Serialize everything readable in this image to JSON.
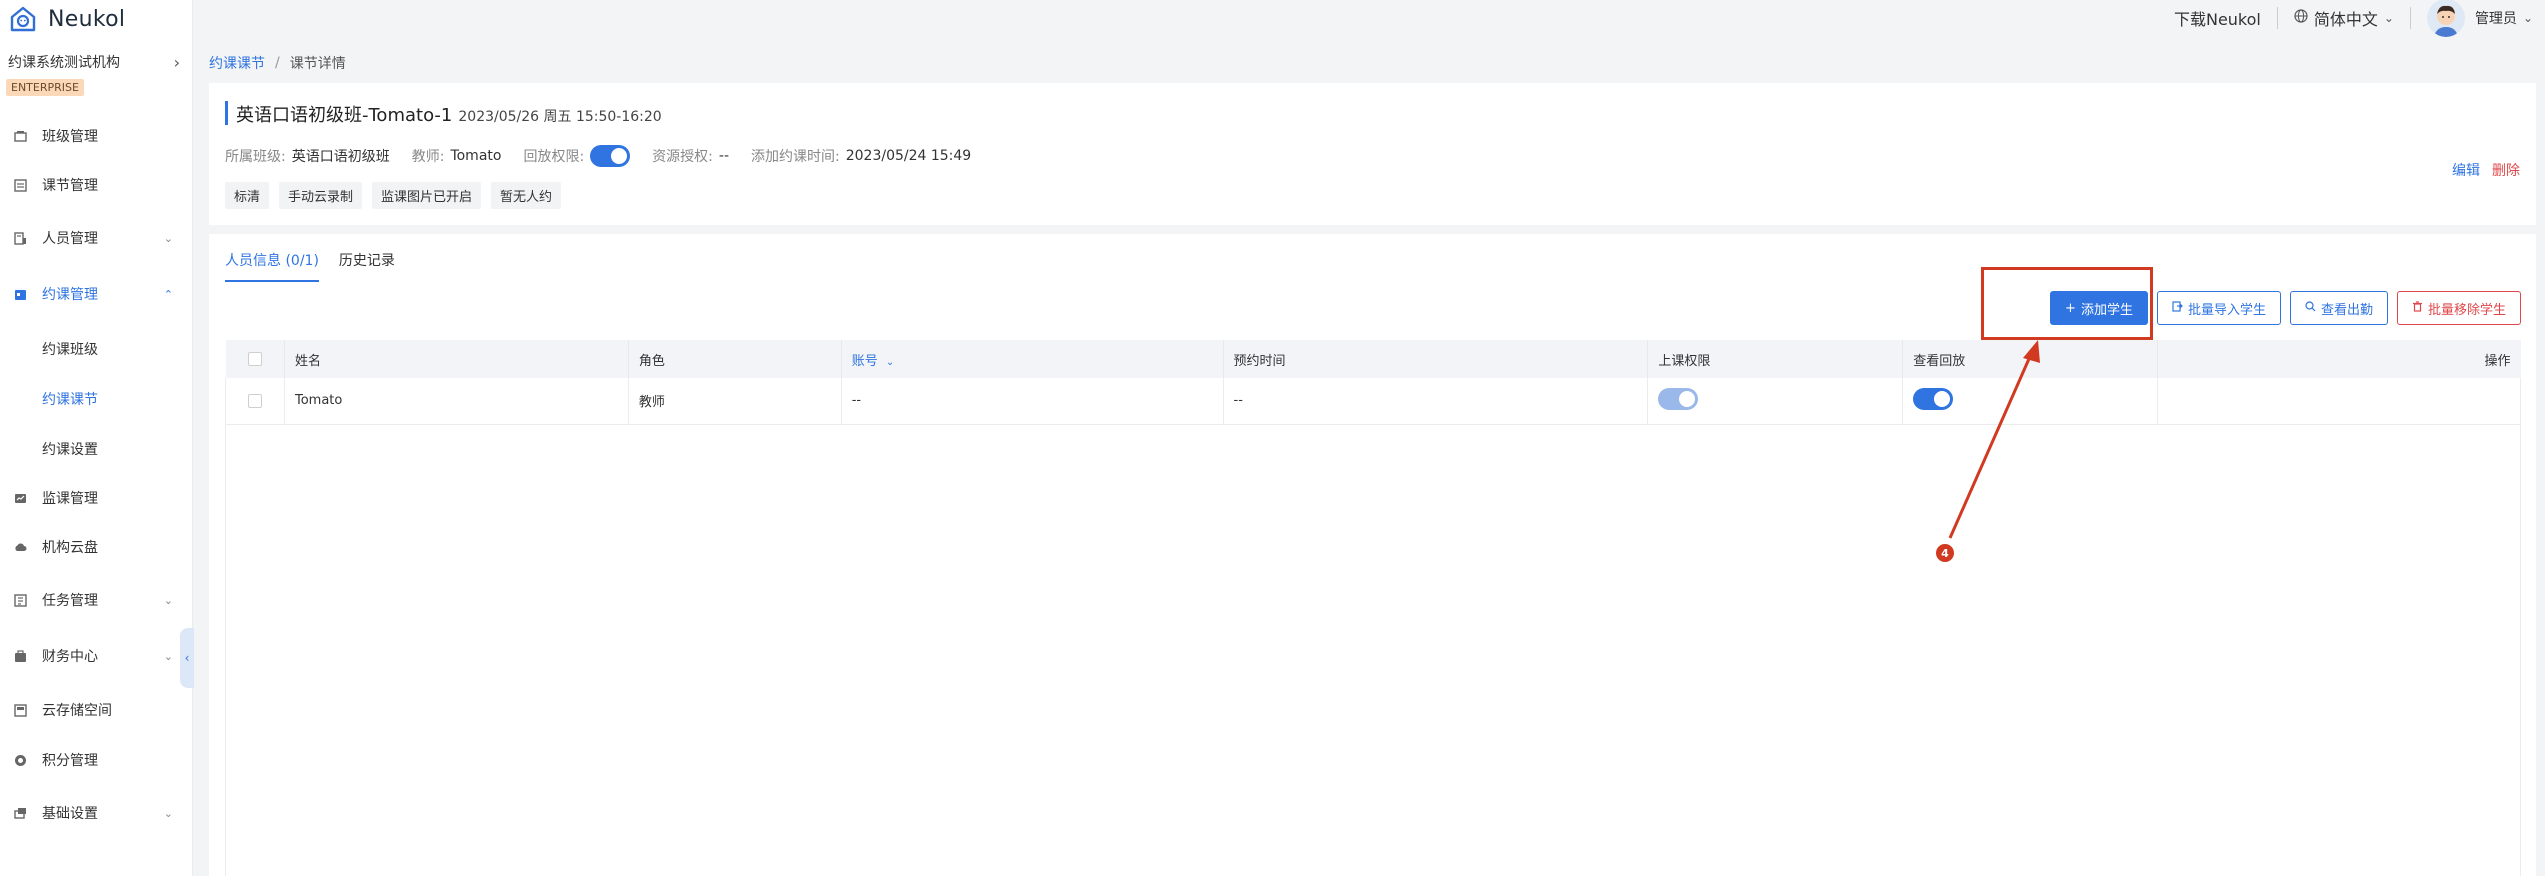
{
  "app": {
    "name": "Neukol",
    "org_name": "约课系统测试机构",
    "edition": "ENTERPRISE"
  },
  "topbar": {
    "download": "下载Neukol",
    "language": "简体中文",
    "user": "管理员"
  },
  "sidebar": {
    "items": [
      {
        "label": "班级管理",
        "icon": "class-icon"
      },
      {
        "label": "课节管理",
        "icon": "lesson-icon"
      },
      {
        "label": "人员管理",
        "icon": "people-icon"
      },
      {
        "label": "约课管理",
        "icon": "booking-icon"
      },
      {
        "label": "监课管理",
        "icon": "monitor-icon"
      },
      {
        "label": "机构云盘",
        "icon": "cloud-icon"
      },
      {
        "label": "任务管理",
        "icon": "task-icon"
      },
      {
        "label": "财务中心",
        "icon": "finance-icon"
      },
      {
        "label": "云存储空间",
        "icon": "storage-icon"
      },
      {
        "label": "积分管理",
        "icon": "points-icon"
      },
      {
        "label": "基础设置",
        "icon": "settings-icon"
      }
    ],
    "sub_items": [
      "约课班级",
      "约课课节",
      "约课设置"
    ]
  },
  "breadcrumb": {
    "parent": "约课课节",
    "separator": "/",
    "current": "课节详情"
  },
  "lesson": {
    "title": "英语口语初级班-Tomato-1",
    "datetime": "2023/05/26 周五 15:50-16:20",
    "class_label": "所属班级:",
    "class_value": "英语口语初级班",
    "teacher_label": "教师:",
    "teacher_value": "Tomato",
    "replay_label": "回放权限:",
    "replay_on": true,
    "resource_label": "资源授权:",
    "resource_value": "--",
    "added_label": "添加约课时间:",
    "added_value": "2023/05/24 15:49",
    "tags": [
      "标清",
      "手动云录制",
      "监课图片已开启",
      "暂无人约"
    ],
    "edit": "编辑",
    "delete": "删除"
  },
  "tabs": {
    "members": "人员信息 (0/1)",
    "history": "历史记录"
  },
  "toolbar": {
    "add_student": "添加学生",
    "batch_import": "批量导入学生",
    "view_attendance": "查看出勤",
    "batch_remove": "批量移除学生"
  },
  "table": {
    "headers": {
      "name": "姓名",
      "role": "角色",
      "account": "账号",
      "booking_time": "预约时间",
      "class_permission": "上课权限",
      "view_replay": "查看回放",
      "actions": "操作"
    },
    "rows": [
      {
        "name": "Tomato",
        "role": "教师",
        "account": "--",
        "booking_time": "--",
        "class_permission": true,
        "view_replay": true
      }
    ]
  },
  "annotation": {
    "number": "4"
  },
  "colors": {
    "accent": "#2f74e0",
    "danger": "#e0474a",
    "annotation": "#d13a21",
    "enterprise_badge": "#fbd9b8"
  }
}
